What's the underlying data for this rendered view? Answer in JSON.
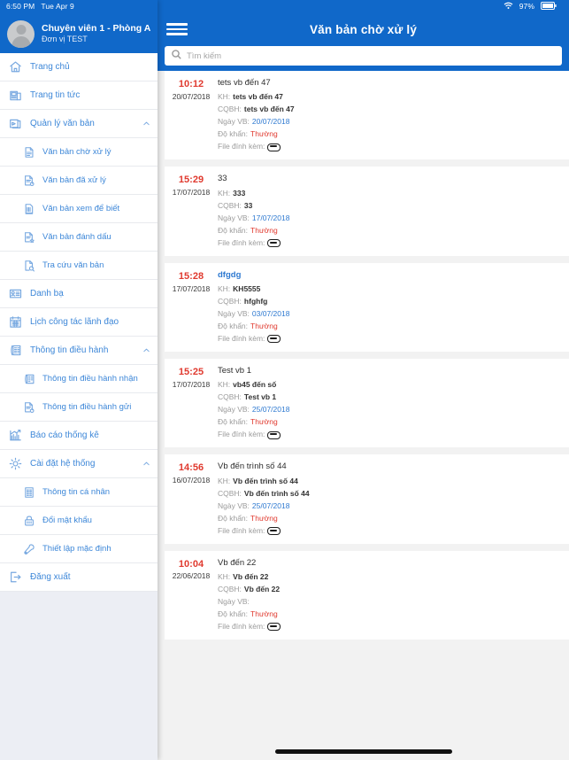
{
  "status_bar": {
    "time": "6:50 PM",
    "date": "Tue Apr 9",
    "wifi_icon": "wifi-icon",
    "battery_text": "97%"
  },
  "sidebar": {
    "user": {
      "name": "Chuyên viên 1 - Phòng A",
      "org": "Đơn vị TEST",
      "avatar_icon": "avatar-person-icon"
    },
    "items": [
      {
        "label": "Trang chủ",
        "icon": "home-icon",
        "level": "top",
        "expandable": false
      },
      {
        "label": "Trang tin tức",
        "icon": "news-icon",
        "level": "top",
        "expandable": false
      },
      {
        "label": "Quản lý văn bản",
        "icon": "document-manage-icon",
        "level": "top",
        "expandable": true,
        "chevron": "chevron-up-icon"
      },
      {
        "label": "Văn bản chờ xử lý",
        "icon": "doc-pending-icon",
        "level": "sub",
        "expandable": false
      },
      {
        "label": "Văn bản đã xử lý",
        "icon": "doc-done-icon",
        "level": "sub",
        "expandable": false
      },
      {
        "label": "Văn bản xem để biết",
        "icon": "doc-info-icon",
        "level": "sub",
        "expandable": false
      },
      {
        "label": "Văn bản đánh dấu",
        "icon": "doc-star-icon",
        "level": "sub",
        "expandable": false
      },
      {
        "label": "Tra cứu văn bản",
        "icon": "doc-search-icon",
        "level": "sub",
        "expandable": false
      },
      {
        "label": "Danh bạ",
        "icon": "contacts-icon",
        "level": "top",
        "expandable": false
      },
      {
        "label": "Lịch công tác lãnh đạo",
        "icon": "calendar-icon",
        "level": "top",
        "expandable": false
      },
      {
        "label": "Thông tin điều hành",
        "icon": "building-icon",
        "level": "top",
        "expandable": true,
        "chevron": "chevron-up-icon"
      },
      {
        "label": "Thông tin điều hành nhận",
        "icon": "building-receive-icon",
        "level": "sub",
        "expandable": false
      },
      {
        "label": "Thông tin điều hành gửi",
        "icon": "doc-send-icon",
        "level": "sub",
        "expandable": false
      },
      {
        "label": "Báo cáo thống kê",
        "icon": "chart-bar-icon",
        "level": "top",
        "expandable": false
      },
      {
        "label": "Cài đặt hệ thống",
        "icon": "gear-icon",
        "level": "top",
        "expandable": true,
        "chevron": "chevron-up-icon"
      },
      {
        "label": "Thông tin cá nhân",
        "icon": "profile-card-icon",
        "level": "sub",
        "expandable": false
      },
      {
        "label": "Đổi mật khẩu",
        "icon": "lock-icon",
        "level": "sub",
        "expandable": false
      },
      {
        "label": "Thiết lập mặc định",
        "icon": "wrench-icon",
        "level": "sub",
        "expandable": false
      },
      {
        "label": "Đăng xuất",
        "icon": "logout-icon",
        "level": "top",
        "expandable": false
      }
    ]
  },
  "appbar": {
    "menu_icon": "hamburger-icon",
    "title": "Văn bản chờ xử lý"
  },
  "search": {
    "icon": "search-icon",
    "placeholder": "Tìm kiếm",
    "value": ""
  },
  "labels": {
    "kh": "KH:",
    "cqbh": "CQBH:",
    "ngay_vb": "Ngày VB:",
    "do_khan": "Độ khẩn:",
    "file": "File đính kèm:",
    "attachment_icon": "paperclip-icon"
  },
  "colors": {
    "brand_blue": "#1068c9",
    "accent_red": "#e03a2f",
    "link_blue": "#2f7ad1",
    "sidebar_bg": "#eceef4",
    "muted": "#9b9b9b"
  },
  "documents": [
    {
      "time": "10:12",
      "date": "20/07/2018",
      "title": "tets vb đến 47",
      "title_unread": false,
      "kh": "tets vb đến 47",
      "cqbh": "tets vb đến 47",
      "ngay_vb": "20/07/2018",
      "do_khan": "Thường",
      "has_file": true
    },
    {
      "time": "15:29",
      "date": "17/07/2018",
      "title": "33",
      "title_unread": false,
      "kh": "333",
      "cqbh": "33",
      "ngay_vb": "17/07/2018",
      "do_khan": "Thường",
      "has_file": true
    },
    {
      "time": "15:28",
      "date": "17/07/2018",
      "title": "dfgdg",
      "title_unread": true,
      "kh": "KH5555",
      "cqbh": "hfghfg",
      "ngay_vb": "03/07/2018",
      "do_khan": "Thường",
      "has_file": true
    },
    {
      "time": "15:25",
      "date": "17/07/2018",
      "title": "Test vb 1",
      "title_unread": false,
      "kh": "vb45 đến số",
      "cqbh": "Test vb 1",
      "ngay_vb": "25/07/2018",
      "do_khan": "Thường",
      "has_file": true
    },
    {
      "time": "14:56",
      "date": "16/07/2018",
      "title": "Vb đến trình số 44",
      "title_unread": false,
      "kh": "Vb đến trình số 44",
      "cqbh": "Vb đến trình số 44",
      "ngay_vb": "25/07/2018",
      "do_khan": "Thường",
      "has_file": true
    },
    {
      "time": "10:04",
      "date": "22/06/2018",
      "title": "Vb đến 22",
      "title_unread": false,
      "kh": "Vb đến 22",
      "cqbh": "Vb đến 22",
      "ngay_vb": "",
      "do_khan": "Thường",
      "has_file": true
    }
  ]
}
